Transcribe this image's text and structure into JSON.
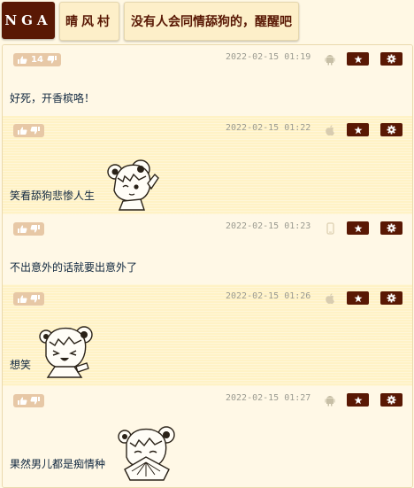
{
  "header": {
    "site_logo": "NGA",
    "forum_tab": "晴风村",
    "thread_title": "没有人会同情舔狗的，醒醒吧"
  },
  "colors": {
    "accent": "#591804",
    "background": "#fff8e4",
    "alt_row": "#fff2c5",
    "vote_button": "#e7c8a6",
    "timestamp": "#9b9b91"
  },
  "posts": [
    {
      "vote_count": "14",
      "timestamp": "2022-02-15 01:19",
      "device_icon": "android-icon",
      "content": "好死，开香槟咯！",
      "sticker": ""
    },
    {
      "vote_count": "",
      "timestamp": "2022-02-15 01:22",
      "device_icon": "apple-icon",
      "content": "笑看舔狗悲惨人生",
      "sticker": "winking-girl-sticker"
    },
    {
      "vote_count": "",
      "timestamp": "2022-02-15 01:23",
      "device_icon": "mobile-phone-icon",
      "content": "不出意外的话就要出意外了",
      "sticker": ""
    },
    {
      "vote_count": "",
      "timestamp": "2022-02-15 01:26",
      "device_icon": "apple-icon",
      "content": "想笑",
      "sticker": "laughing-girl-sticker"
    },
    {
      "vote_count": "",
      "timestamp": "2022-02-15 01:27",
      "device_icon": "android-icon",
      "content": "果然男儿都是痴情种",
      "sticker": "fan-girl-sticker"
    }
  ]
}
